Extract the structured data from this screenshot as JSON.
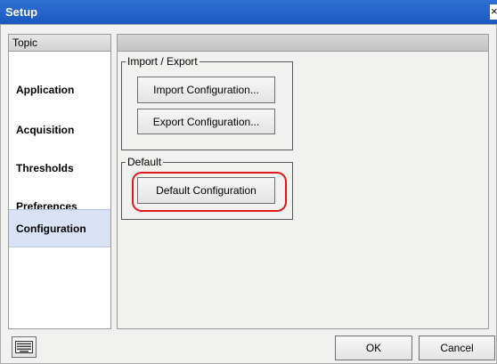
{
  "window": {
    "title": "Setup",
    "close_glyph": "×"
  },
  "sidebar": {
    "header": "Topic",
    "items": [
      {
        "label": "Application"
      },
      {
        "label": "Acquisition"
      },
      {
        "label": "Thresholds"
      },
      {
        "label": "Preferences"
      },
      {
        "label": "Configuration",
        "selected": true
      }
    ]
  },
  "import_export": {
    "title": "Import / Export",
    "import_button": "Import Configuration...",
    "export_button": "Export Configuration..."
  },
  "default": {
    "title": "Default",
    "default_button": "Default Configuration"
  },
  "footer": {
    "keyboard_icon": "keyboard-icon",
    "ok_button": "OK",
    "cancel_button": "Cancel"
  },
  "colors": {
    "titlebar": "#1b58c0",
    "selected_topic": "#d9e2f4",
    "highlight_outline": "#e01818"
  }
}
